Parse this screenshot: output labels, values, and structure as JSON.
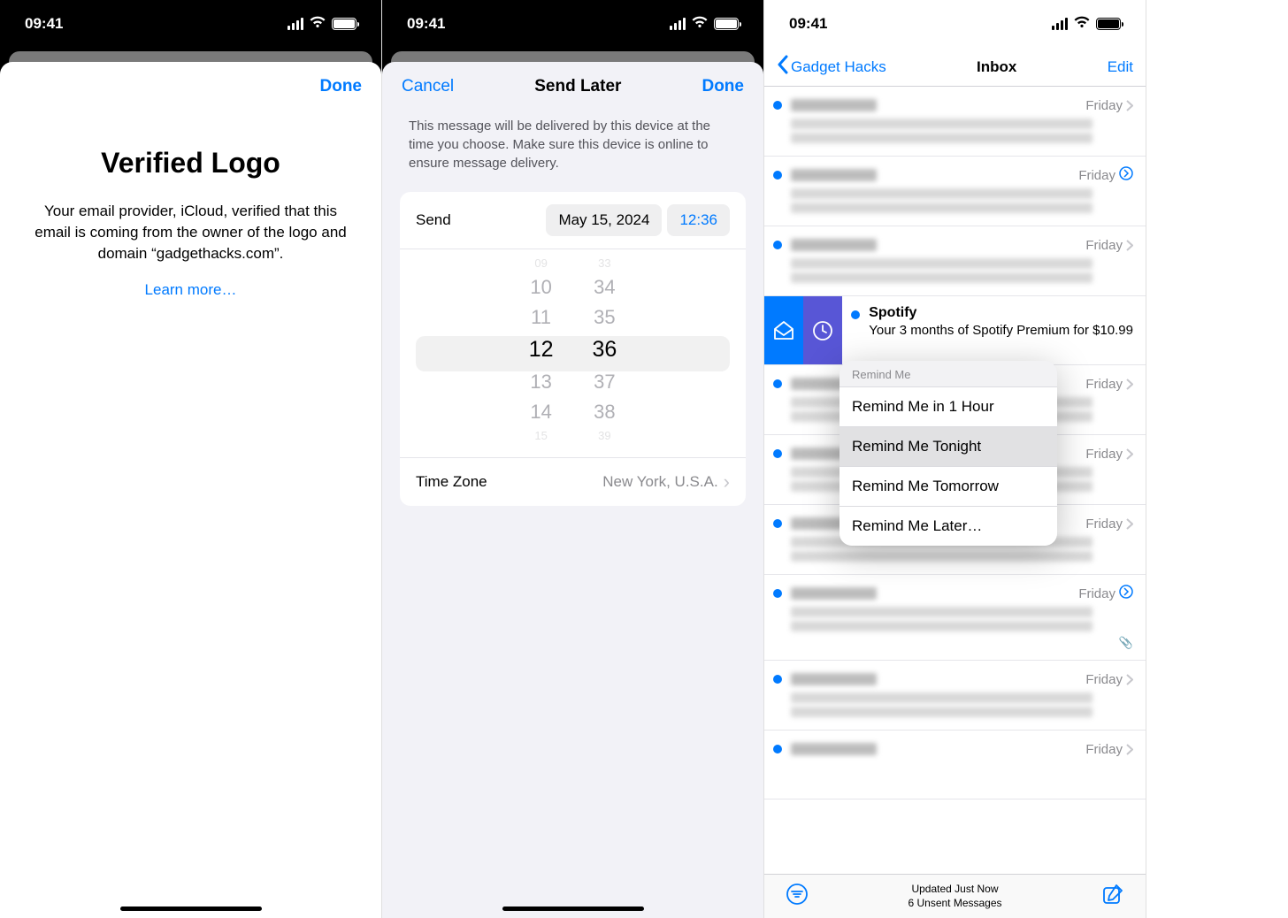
{
  "status_time": "09:41",
  "phone1": {
    "done": "Done",
    "title": "Verified Logo",
    "body": "Your email provider, iCloud, verified that this email is coming from the owner of the logo and domain “gadgethacks.com”.",
    "learn_more": "Learn more…"
  },
  "phone2": {
    "cancel": "Cancel",
    "title": "Send Later",
    "done": "Done",
    "description": "This message will be delivered by this device at the time you choose. Make sure this device is online to ensure message delivery.",
    "send_label": "Send",
    "send_date": "May 15, 2024",
    "send_time": "12:36",
    "picker_hours": [
      "09",
      "10",
      "11",
      "12",
      "13",
      "14",
      "15"
    ],
    "picker_minutes": [
      "33",
      "34",
      "35",
      "36",
      "37",
      "38",
      "39"
    ],
    "tz_label": "Time Zone",
    "tz_value": "New York, U.S.A."
  },
  "phone3": {
    "back": "Gadget Hacks",
    "title": "Inbox",
    "edit": "Edit",
    "item_date": "Friday",
    "spotify_from": "Spotify",
    "spotify_subject": "Your 3 months of Spotify Premium for $10.99",
    "remind_header": "Remind Me",
    "remind_options": [
      "Remind Me in 1 Hour",
      "Remind Me Tonight",
      "Remind Me Tomorrow",
      "Remind Me Later…"
    ],
    "toolbar_line1": "Updated Just Now",
    "toolbar_line2": "6 Unsent Messages"
  }
}
